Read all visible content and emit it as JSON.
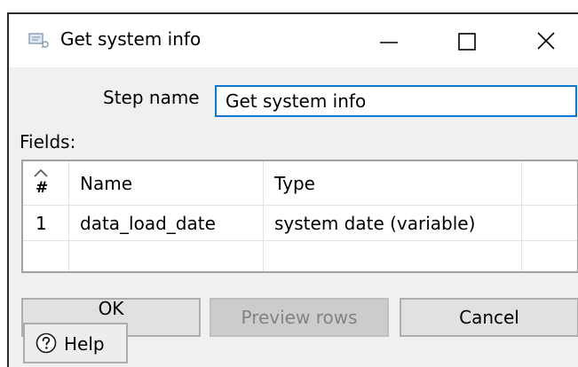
{
  "window": {
    "title": "Get system info",
    "icon": "kettle-step-icon",
    "controls": [
      "minimize-icon",
      "maximize-icon",
      "close-icon"
    ]
  },
  "step_name": {
    "label": "Step name",
    "value": "Get system info"
  },
  "fields": {
    "label": "Fields:",
    "columns": [
      "#",
      "Name",
      "Type"
    ],
    "rows": [
      {
        "index": "1",
        "name": "data_load_date",
        "type": "system date (variable)"
      }
    ]
  },
  "buttons": {
    "ok": "OK",
    "preview": "Preview rows",
    "cancel": "Cancel",
    "help": "Help"
  },
  "colors": {
    "focus_border": "#0a78d7",
    "dialog_bg": "#f0f0f0"
  }
}
